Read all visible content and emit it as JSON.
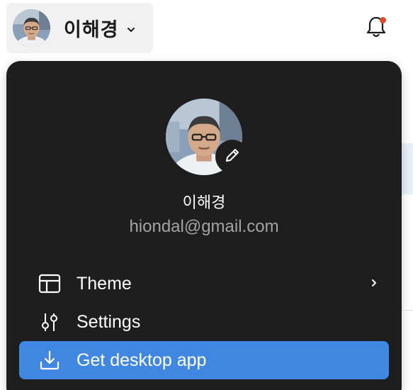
{
  "header": {
    "user_name": "이해경",
    "avatar_icon": "user-avatar",
    "chevron_icon": "chevron-down-icon",
    "notification_icon": "bell-icon",
    "has_unread_notifications": true,
    "notification_dot_color": "#e0482a"
  },
  "menu": {
    "profile": {
      "name": "이해경",
      "email": "hiondal@gmail.com",
      "edit_icon": "pencil-icon"
    },
    "items": [
      {
        "label": "Theme",
        "icon": "layout-icon",
        "has_submenu": true
      },
      {
        "label": "Settings",
        "icon": "sliders-icon",
        "has_submenu": false
      },
      {
        "label": "Get desktop app",
        "icon": "download-icon",
        "highlighted": true
      }
    ],
    "colors": {
      "background": "#1e1e1e",
      "highlight": "#3f87e0",
      "text": "#ffffff",
      "secondary_text": "#a3a3a3"
    }
  }
}
